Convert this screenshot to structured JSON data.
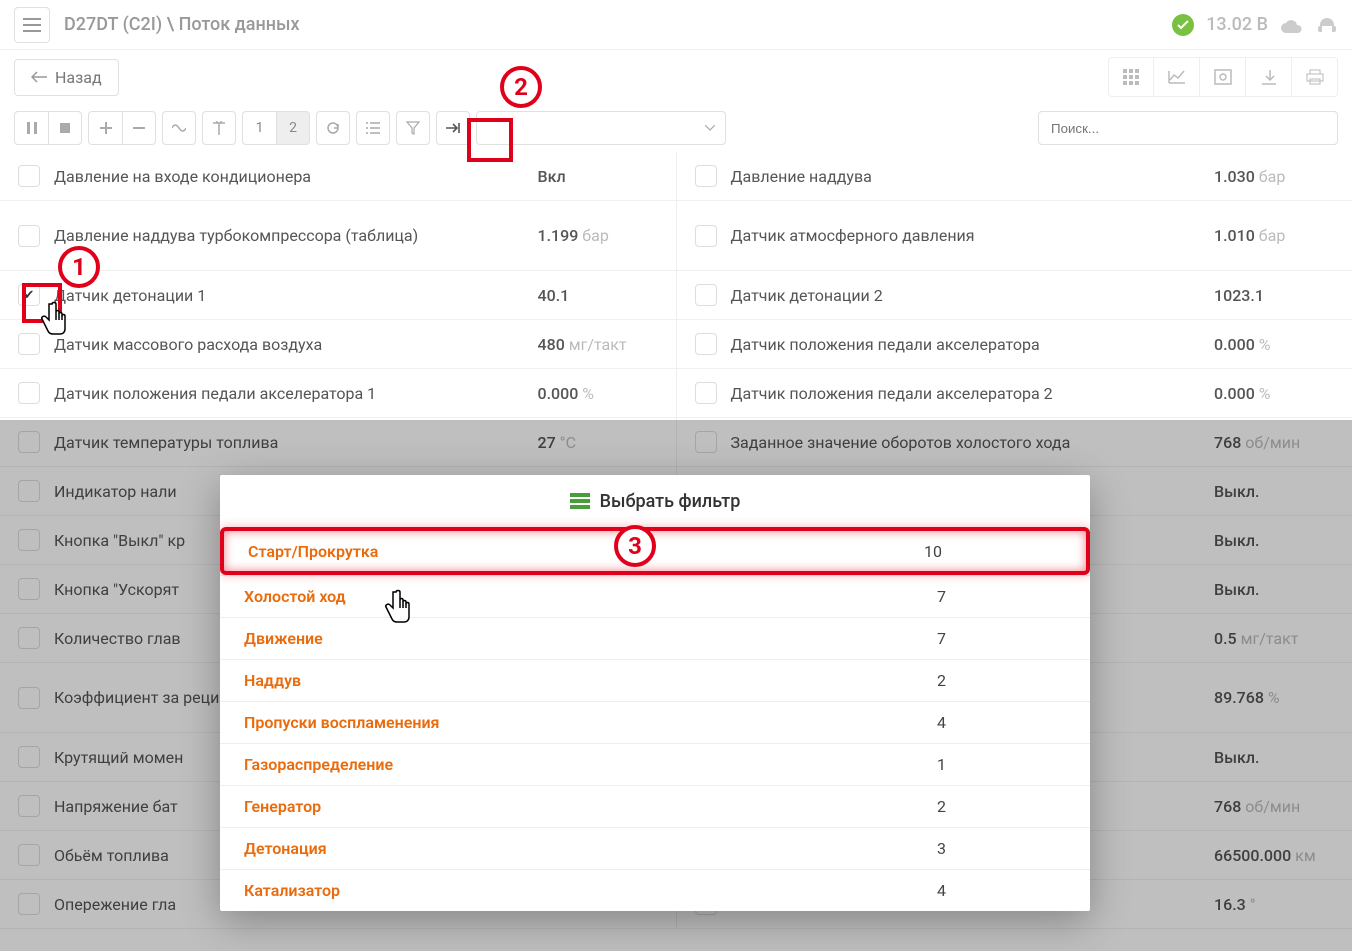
{
  "header": {
    "breadcrumb": "D27DT (C2I) \\ Поток данных",
    "voltage_value": "13.02",
    "voltage_unit": "В"
  },
  "backbar": {
    "back_label": "Назад"
  },
  "toolbar": {
    "num1": "1",
    "num2": "2",
    "search_placeholder": "Поиск..."
  },
  "data": {
    "left": [
      {
        "label": "Давление на входе кондиционера",
        "value": "Вкл",
        "unit": ""
      },
      {
        "label": "Давление наддува турбокомпрессора (таблица)",
        "value": "1.199",
        "unit": "бар",
        "tall": true
      },
      {
        "label": "Датчик детонации 1",
        "value": "40.1",
        "unit": "",
        "checked": true
      },
      {
        "label": "Датчик массового расхода воздуха",
        "value": "480",
        "unit": "мг/такт"
      },
      {
        "label": "Датчик положения педали акселератора 1",
        "value": "0.000",
        "unit": "%"
      },
      {
        "label": "Датчик температуры топлива",
        "value": "27",
        "unit": "°C"
      },
      {
        "label": "Индикатор нали",
        "value": "",
        "unit": ""
      },
      {
        "label": "Кнопка \"Выкл\" кр",
        "value": "",
        "unit": ""
      },
      {
        "label": "Кнопка \"Ускорят",
        "value": "",
        "unit": ""
      },
      {
        "label": "Количество глав",
        "value": "",
        "unit": ""
      },
      {
        "label": "Коэффициент за\nрециркуляции в",
        "value": "",
        "unit": "",
        "tall": true
      },
      {
        "label": "Крутящий момен",
        "value": "",
        "unit": ""
      },
      {
        "label": "Напряжение бат",
        "value": "",
        "unit": ""
      },
      {
        "label": "Обьём топлива",
        "value": "",
        "unit": ""
      },
      {
        "label": "Опережение гла",
        "value": "",
        "unit": ""
      }
    ],
    "right": [
      {
        "label": "Давление наддува",
        "value": "1.030",
        "unit": "бар"
      },
      {
        "label": "Датчик атмосферного давления",
        "value": "1.010",
        "unit": "бар",
        "tall": true
      },
      {
        "label": "Датчик детонации 2",
        "value": "1023.1",
        "unit": ""
      },
      {
        "label": "Датчик положения педали акселератора",
        "value": "0.000",
        "unit": "%"
      },
      {
        "label": "Датчик положения педали акселератора 2",
        "value": "0.000",
        "unit": "%"
      },
      {
        "label": "Заданное значение оборотов холостого хода",
        "value": "768",
        "unit": "об/мин"
      },
      {
        "label": "",
        "value": "Выкл.",
        "unit": ""
      },
      {
        "label": "",
        "value": "Выкл.",
        "unit": ""
      },
      {
        "label": "",
        "value": "Выкл.",
        "unit": ""
      },
      {
        "label": "",
        "value": "0.5",
        "unit": "мг/такт"
      },
      {
        "label": "",
        "value": "89.768",
        "unit": "%",
        "tall": true
      },
      {
        "label": "",
        "value": "Выкл.",
        "unit": ""
      },
      {
        "label": "",
        "value": "768",
        "unit": "об/мин"
      },
      {
        "label": "",
        "value": "66500.000",
        "unit": "км"
      },
      {
        "label": "",
        "value": "16.3",
        "unit": "°"
      }
    ]
  },
  "modal": {
    "title": "Выбрать фильтр",
    "filters": [
      {
        "name": "Старт/Прокрутка",
        "count": "10",
        "highlight": true
      },
      {
        "name": "Холостой ход",
        "count": "7"
      },
      {
        "name": "Движение",
        "count": "7"
      },
      {
        "name": "Наддув",
        "count": "2"
      },
      {
        "name": "Пропуски воспламенения",
        "count": "4"
      },
      {
        "name": "Газораспределение",
        "count": "1"
      },
      {
        "name": "Генератор",
        "count": "2"
      },
      {
        "name": "Детонация",
        "count": "3"
      },
      {
        "name": "Катализатор",
        "count": "4"
      }
    ]
  },
  "callouts": {
    "c1": "1",
    "c2": "2",
    "c3": "3"
  }
}
